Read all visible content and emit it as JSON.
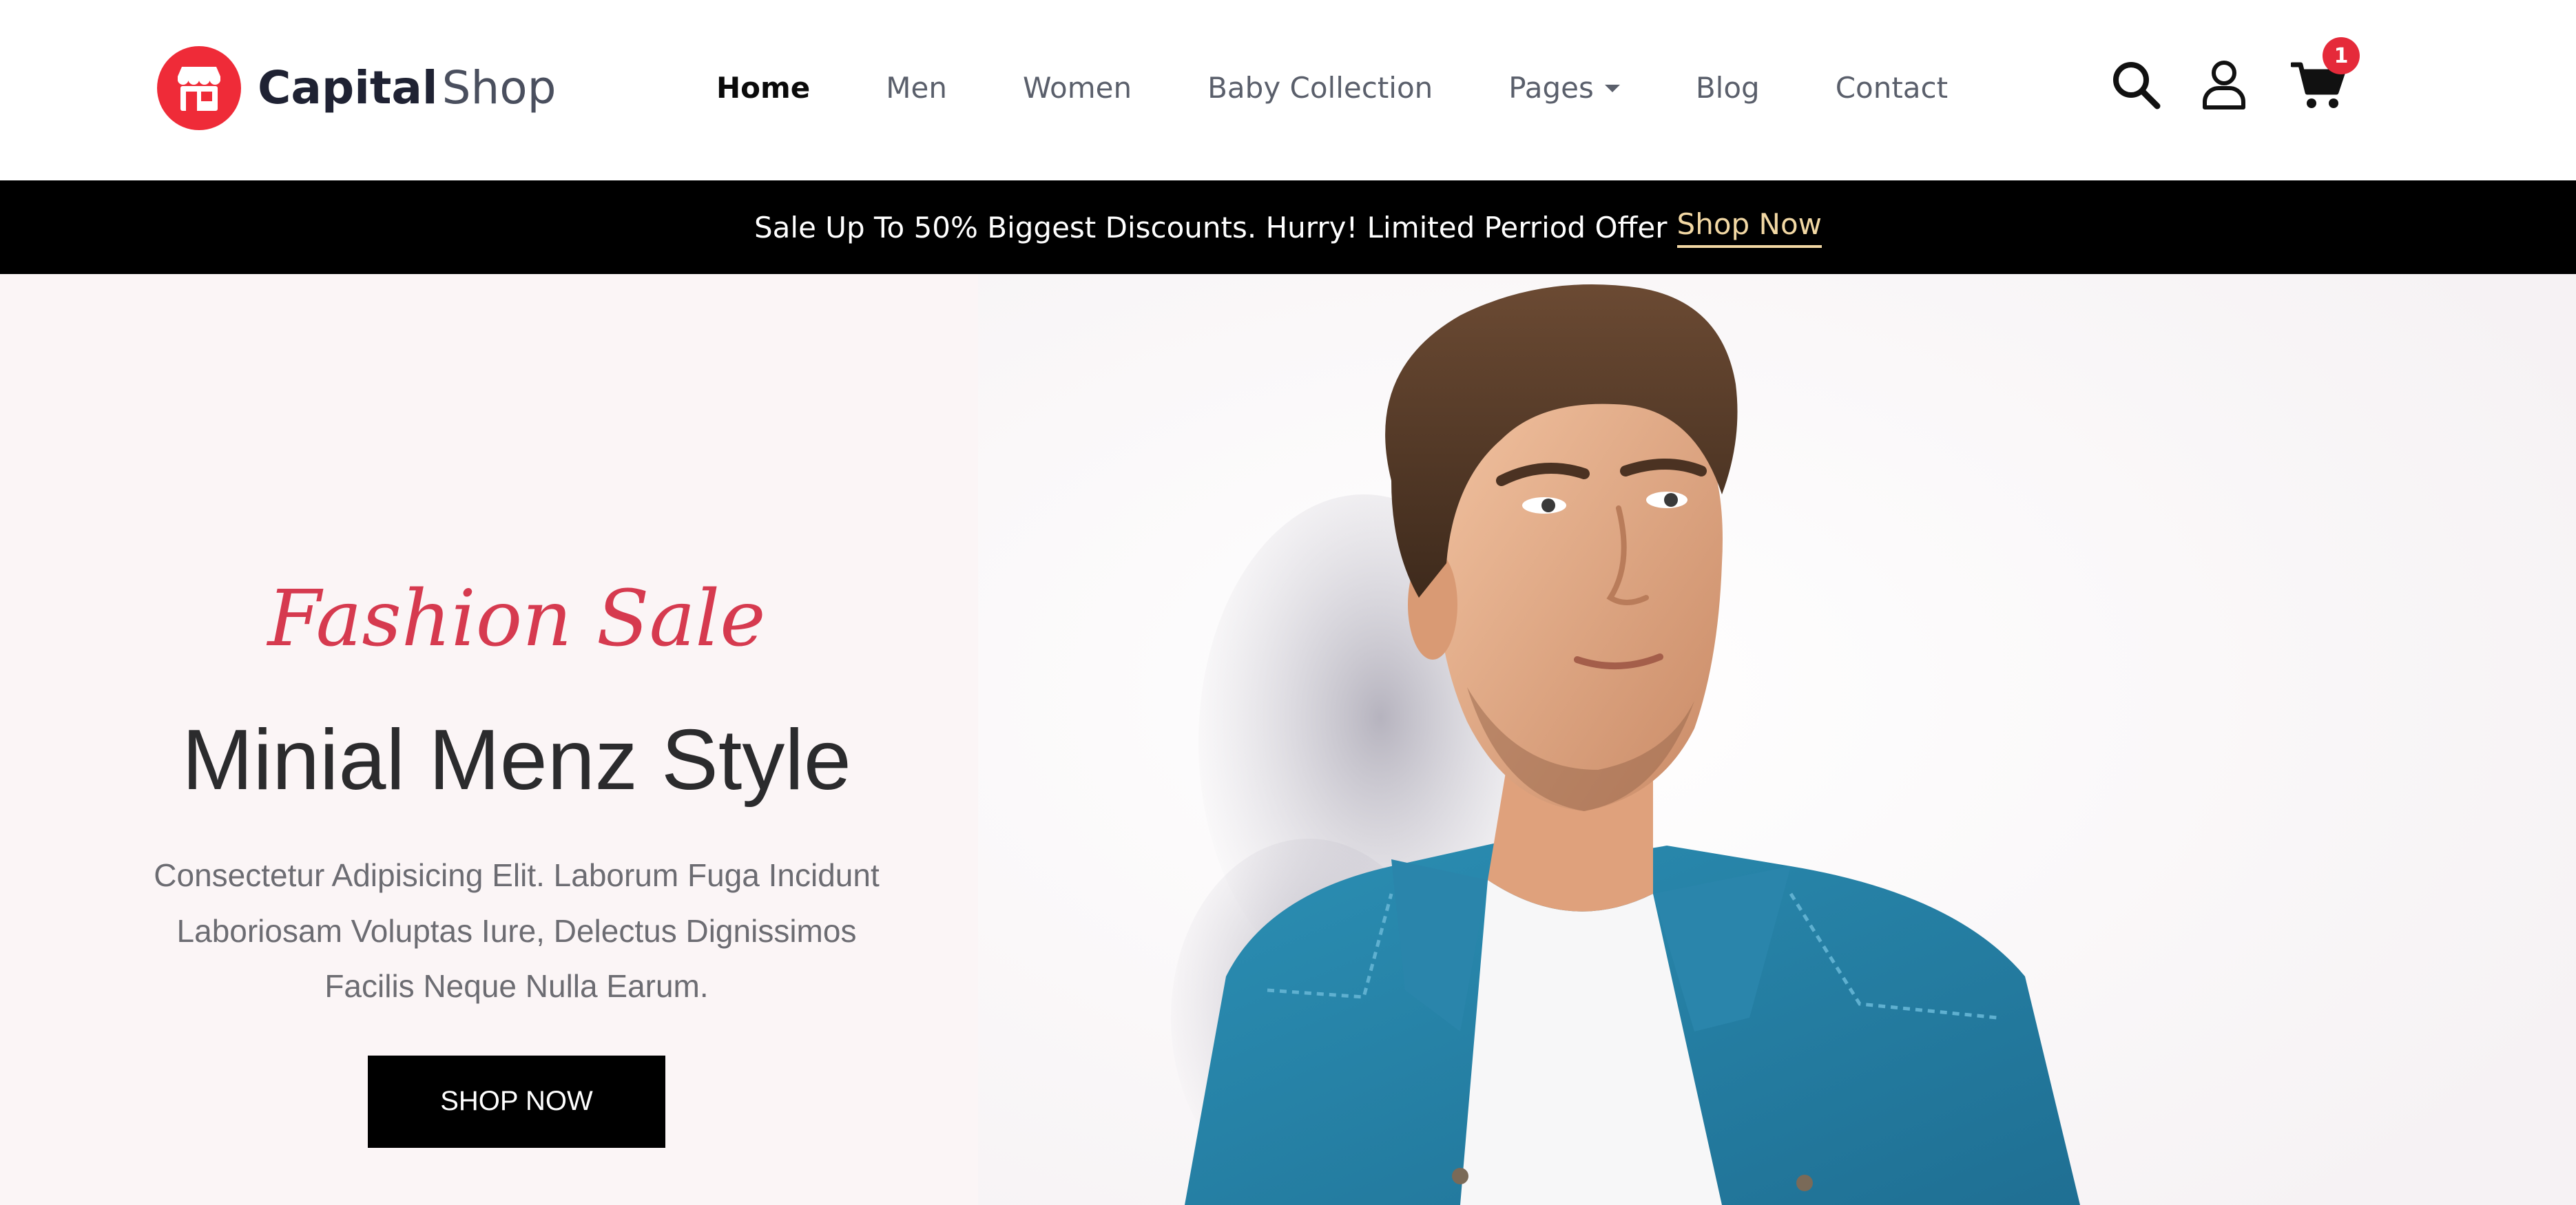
{
  "brand": {
    "name_bold": "Capital",
    "name_light": "Shop",
    "accent": "#ef2b38"
  },
  "nav": {
    "items": [
      {
        "label": "Home",
        "active": true
      },
      {
        "label": "Men"
      },
      {
        "label": "Women"
      },
      {
        "label": "Baby Collection"
      },
      {
        "label": "Pages",
        "dropdown": true
      },
      {
        "label": "Blog"
      },
      {
        "label": "Contact"
      }
    ]
  },
  "header_icons": {
    "search": "search-icon",
    "account": "user-icon",
    "cart": "cart-icon",
    "cart_count": "1"
  },
  "promo": {
    "text": "Sale Up To 50% Biggest Discounts. Hurry! Limited Perriod Offer",
    "link": "Shop Now",
    "link_color": "#f2d8a4"
  },
  "hero": {
    "tagline": "Fashion Sale",
    "title": "Minial Menz Style",
    "description": "Consectetur Adipisicing Elit. Laborum Fuga Incidunt Laboriosam Voluptas Iure, Delectus Dignissimos Facilis Neque Nulla Earum.",
    "button": "SHOP NOW",
    "tagline_color": "#d63a4f"
  }
}
